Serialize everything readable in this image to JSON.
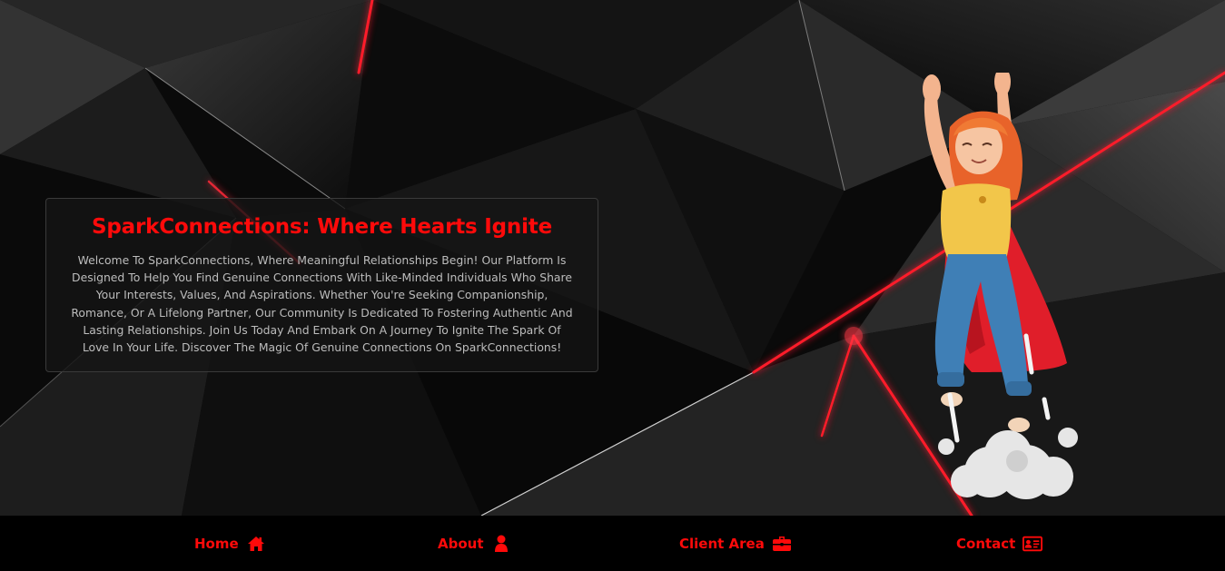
{
  "hero": {
    "title": "SparkConnections: Where Hearts Ignite",
    "description": "Welcome To SparkConnections, Where Meaningful Relationships Begin! Our Platform Is Designed To Help You Find Genuine Connections With Like-Minded Individuals Who Share Your Interests, Values, And Aspirations. Whether You're Seeking Companionship, Romance, Or A Lifelong Partner, Our Community Is Dedicated To Fostering Authentic And Lasting Relationships. Join Us Today And Embark On A Journey To Ignite The Spark Of Love In Your Life. Discover The Magic Of Genuine Connections On SparkConnections!"
  },
  "nav": {
    "items": [
      {
        "label": "Home",
        "icon": "home-icon"
      },
      {
        "label": "About",
        "icon": "user-icon"
      },
      {
        "label": "Client Area",
        "icon": "briefcase-icon"
      },
      {
        "label": "Contact",
        "icon": "contact-card-icon"
      }
    ]
  },
  "colors": {
    "accent": "#ff0a0a",
    "background": "#000000",
    "card_text": "#bdbdbd"
  }
}
